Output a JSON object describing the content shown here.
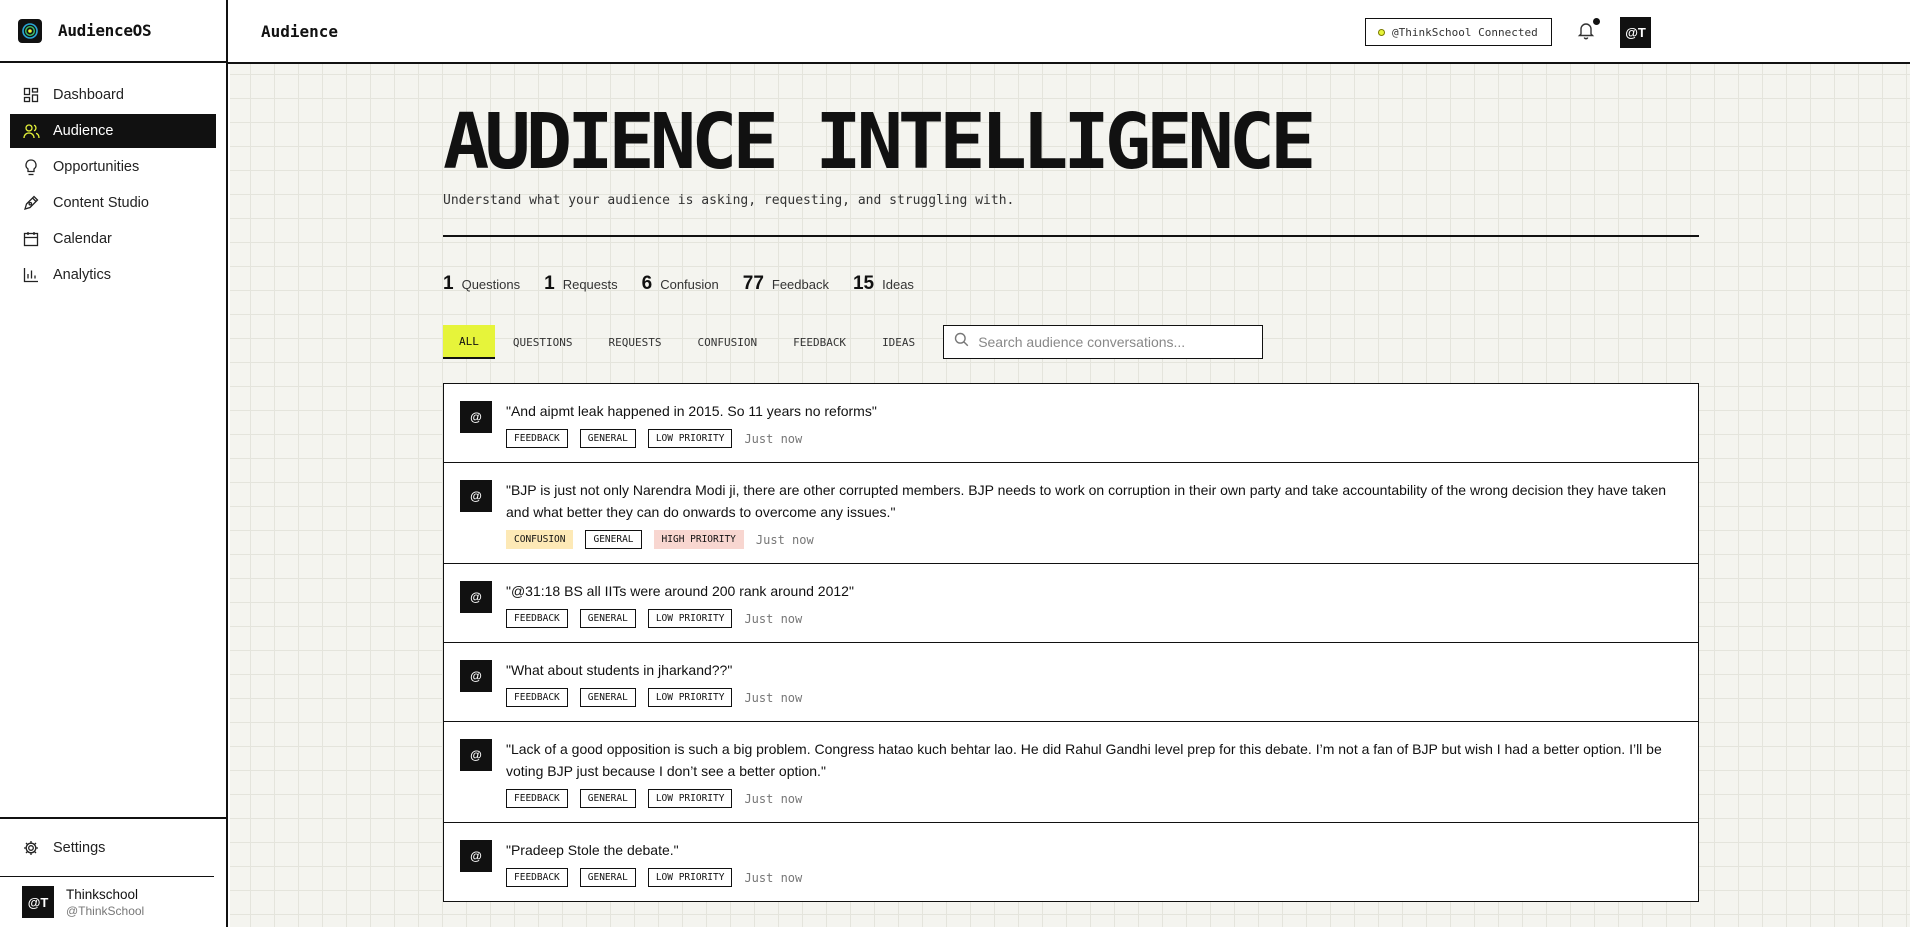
{
  "app": {
    "name": "AudienceOS"
  },
  "sidebar": {
    "items": [
      {
        "label": "Dashboard",
        "icon": "dashboard-icon"
      },
      {
        "label": "Audience",
        "icon": "users-icon"
      },
      {
        "label": "Opportunities",
        "icon": "lightbulb-icon"
      },
      {
        "label": "Content Studio",
        "icon": "pen-icon"
      },
      {
        "label": "Calendar",
        "icon": "calendar-icon"
      },
      {
        "label": "Analytics",
        "icon": "bar-chart-icon"
      }
    ],
    "active_index": 1,
    "settings_label": "Settings",
    "profile": {
      "avatar": "@T",
      "name": "Thinkschool",
      "handle": "@ThinkSchool"
    }
  },
  "header": {
    "title": "Audience",
    "connection": "@ThinkSchool Connected",
    "avatar": "@T"
  },
  "page": {
    "title": "AUDIENCE INTELLIGENCE",
    "subtitle": "Understand what your audience is asking, requesting, and struggling with."
  },
  "stats": [
    {
      "value": "1",
      "label": "Questions"
    },
    {
      "value": "1",
      "label": "Requests"
    },
    {
      "value": "6",
      "label": "Confusion"
    },
    {
      "value": "77",
      "label": "Feedback"
    },
    {
      "value": "15",
      "label": "Ideas"
    }
  ],
  "filters": {
    "tabs": [
      "ALL",
      "QUESTIONS",
      "REQUESTS",
      "CONFUSION",
      "FEEDBACK",
      "IDEAS"
    ],
    "active": "ALL",
    "search_placeholder": "Search audience conversations..."
  },
  "conversations": [
    {
      "avatar": "@",
      "text": "\"And aipmt leak happened in 2015. So 11 years no reforms\"",
      "type": "FEEDBACK",
      "category": "GENERAL",
      "priority": "LOW PRIORITY",
      "time": "Just now"
    },
    {
      "avatar": "@",
      "text": "\"BJP is just not only Narendra Modi ji, there are other corrupted members. BJP needs to work on corruption in their own party and take accountability of the wrong decision they have taken and what better they can do onwards to overcome any issues.\"",
      "type": "CONFUSION",
      "category": "GENERAL",
      "priority": "HIGH PRIORITY",
      "time": "Just now"
    },
    {
      "avatar": "@",
      "text": "\"@31:18 BS all IITs were around 200 rank around 2012\"",
      "type": "FEEDBACK",
      "category": "GENERAL",
      "priority": "LOW PRIORITY",
      "time": "Just now"
    },
    {
      "avatar": "@",
      "text": "\"What about students in jharkand??\"",
      "type": "FEEDBACK",
      "category": "GENERAL",
      "priority": "LOW PRIORITY",
      "time": "Just now"
    },
    {
      "avatar": "@",
      "text": "\"Lack of a good opposition is such a big problem. Congress hatao kuch behtar lao. He did Rahul Gandhi level prep for this debate. I’m not a fan of BJP but wish I had a better option. I’ll be voting BJP just because I don’t see a better option.\"",
      "type": "FEEDBACK",
      "category": "GENERAL",
      "priority": "LOW PRIORITY",
      "time": "Just now"
    },
    {
      "avatar": "@",
      "text": "\"Pradeep Stole the debate.\"",
      "type": "FEEDBACK",
      "category": "GENERAL",
      "priority": "LOW PRIORITY",
      "time": "Just now"
    }
  ],
  "colors": {
    "accent": "#e6f43a",
    "ink": "#111111",
    "canvas": "#f4f4ef",
    "confusion_tag": "#fde9b6",
    "high_priority_tag": "#f8d6d0"
  }
}
